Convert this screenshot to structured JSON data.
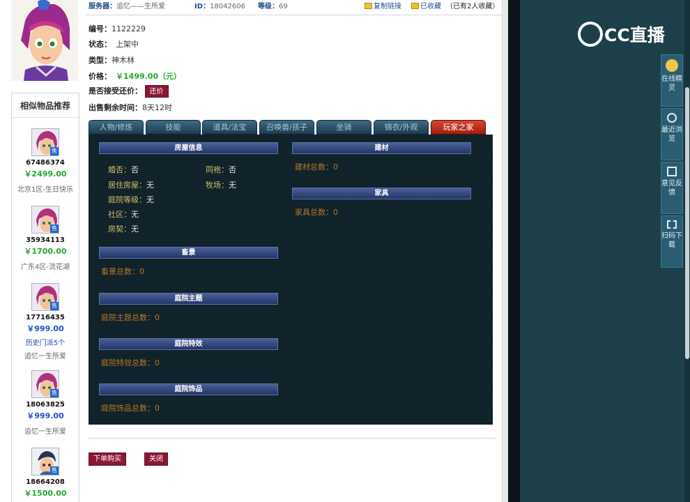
{
  "header": {
    "server_label": "服务器：",
    "server_value": "追忆——生所爱",
    "id_label": "ID：",
    "id_value": "18042606",
    "level_label": "等级：",
    "level_value": "69",
    "copy_link": "复制链接",
    "favorited": "已收藏",
    "fav_count": "（已有2人收藏）"
  },
  "info": {
    "number_label": "编号：",
    "number_value": "1122229",
    "status_label": "状态：",
    "status_value": "上架中",
    "type_label": "类型：",
    "type_value": "神木林",
    "price_label": "价格：",
    "price_value": "￥1499.00（元）",
    "counter_offer_label": "是否接受还价：",
    "counter_offer_button": "还价",
    "time_left_label": "出售剩余时间：",
    "time_left_value": "8天12时"
  },
  "tabs": [
    {
      "label": "人物/修炼",
      "active": false
    },
    {
      "label": "技能",
      "active": false
    },
    {
      "label": "道具/法宝",
      "active": false
    },
    {
      "label": "召唤兽/孩子",
      "active": false
    },
    {
      "label": "坐骑",
      "active": false
    },
    {
      "label": "锦衣/外观",
      "active": false
    },
    {
      "label": "玩家之家",
      "active": true
    }
  ],
  "panel": {
    "house_info": {
      "title": "房屋信息",
      "married_label": "婚否：",
      "married_value": "否",
      "robe_label": "同袍：",
      "robe_value": "否",
      "house_label": "居住房屋：",
      "house_value": "无",
      "ranch_label": "牧场：",
      "ranch_value": "无",
      "yard_level_label": "庭院等级：",
      "yard_level_value": "无",
      "community_label": "社区：",
      "community_value": "无",
      "deed_label": "房契：",
      "deed_value": "无"
    },
    "materials": {
      "title": "建材",
      "count_text": "建材总数：0"
    },
    "furniture": {
      "title": "家具",
      "count_text": "家具总数：0"
    },
    "scenery": {
      "title": "畜景",
      "count_text": "畜景总数：0"
    },
    "yard_theme": {
      "title": "庭院主题",
      "count_text": "庭院主题总数：0"
    },
    "yard_effect": {
      "title": "庭院特效",
      "count_text": "庭院特效总数：0"
    },
    "yard_decor": {
      "title": "庭院饰品",
      "count_text": "庭院饰品总数：0"
    }
  },
  "actions": {
    "buy": "下单购买",
    "close": "关闭"
  },
  "recommend": {
    "title": "相似物品推荐",
    "sell_badge": "售",
    "items": [
      {
        "id": "67486374",
        "price": "￥2499.00",
        "price_color": "green",
        "server": "北京1区-生日快乐"
      },
      {
        "id": "35934113",
        "price": "￥1700.00",
        "price_color": "green",
        "server": "广东4区-流花湖"
      },
      {
        "id": "17716435",
        "price": "￥999.00",
        "price_color": "blue",
        "extra": "历史门派5个",
        "server": "追忆一生所爱"
      },
      {
        "id": "18063825",
        "price": "￥999.00",
        "price_color": "blue",
        "server": "追忆一生所爱"
      },
      {
        "id": "18664208",
        "price": "￥1500.00",
        "price_color": "green"
      }
    ]
  },
  "right_panel": {
    "logo_text": "CC直播",
    "tools": [
      {
        "label": "在线精灵",
        "icon": "sprite-icon"
      },
      {
        "label": "最近浏览",
        "icon": "clock-icon"
      },
      {
        "label": "意见反馈",
        "icon": "edit-icon"
      },
      {
        "label": "扫码下载",
        "icon": "scan-icon"
      }
    ]
  },
  "colors": {
    "accent_red": "#8b1734",
    "price_green": "#24a82b",
    "price_blue": "#1d4fc4",
    "panel_bg": "#0f2129",
    "tab_active": "#c0341c",
    "right_panel_bg": "#1c3f4a"
  }
}
